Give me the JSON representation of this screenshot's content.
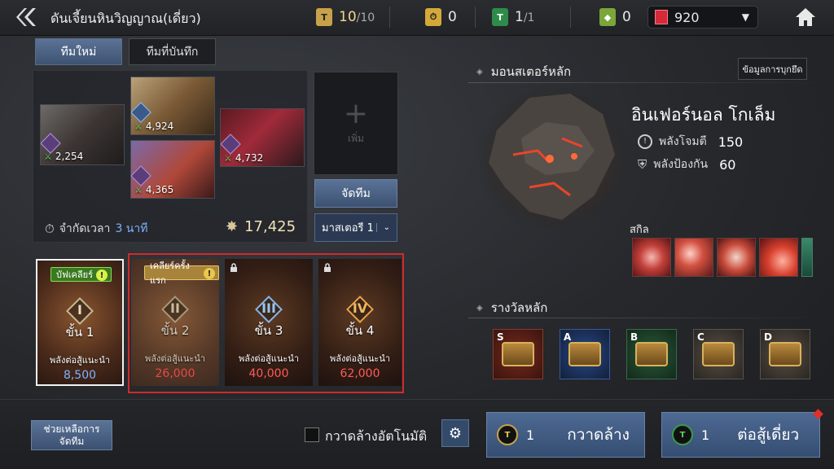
{
  "header": {
    "title": "ดันเจี้ยนหินวิญญาณ(เดี่ยว)",
    "ticket_count": "10",
    "ticket_max": "/10",
    "clock_item_count": "0",
    "green_ticket_count": "1",
    "green_ticket_max": "/1",
    "crystal_count": "0",
    "gem_count": "920"
  },
  "tabs": {
    "new_team": "ทีมใหม่",
    "saved_team": "ทีมที่บันทึก"
  },
  "team": {
    "heroes": [
      {
        "power": "2,254"
      },
      {
        "power": "4,924"
      },
      {
        "power": "4,365"
      },
      {
        "power": "4,732"
      }
    ],
    "add_label": "เพิ่ม",
    "arrange_label": "จัดทีม",
    "master_label": "มาสเตอรี 1",
    "time_limit_label": "จำกัดเวลา",
    "time_limit_value": "3 นาที",
    "combat_power": "17,425"
  },
  "stages": [
    {
      "roman": "I",
      "step": "ขั้น 1",
      "badge": "บัฟเคลียร์",
      "rec_label": "พลังต่อสู้แนะนำ",
      "rec_value": "8,500"
    },
    {
      "roman": "II",
      "step": "ขั้น 2",
      "badge": "เคลียร์ครั้งแรก",
      "rec_label": "พลังต่อสู้แนะนำ",
      "rec_value": "26,000"
    },
    {
      "roman": "III",
      "step": "ขั้น 3",
      "rec_label": "พลังต่อสู้แนะนำ",
      "rec_value": "40,000"
    },
    {
      "roman": "IV",
      "step": "ขั้น 4",
      "rec_label": "พลังต่อสู้แนะนำ",
      "rec_value": "62,000"
    }
  ],
  "boss": {
    "section_title": "มอนสเตอร์หลัก",
    "info_button": "ข้อมูลการบุกยึด",
    "name": "อินเฟอร์นอล โกเล็ม",
    "attack_label": "พลังโจมตี",
    "attack_value": "150",
    "defense_label": "พลังป้องกัน",
    "defense_value": "60",
    "skills_label": "สกิล"
  },
  "rewards": {
    "section_title": "รางวัลหลัก",
    "grades": [
      "S",
      "A",
      "B",
      "C",
      "D"
    ]
  },
  "bottom": {
    "help_line1": "ช่วยเหลือการ",
    "help_line2": "จัดทีม",
    "auto_sweep": "กวาดล้างอัตโนมัติ",
    "sweep_cost": "1",
    "sweep_label": "กวาดล้าง",
    "solo_cost": "1",
    "solo_label": "ต่อสู้เดี่ยว"
  },
  "colors": {
    "accent_blue": "#4e6a93",
    "recommended_red": "#ff5a5a",
    "recommended_ok": "#7fb3ff",
    "highlight_frame": "#d22a2a"
  }
}
